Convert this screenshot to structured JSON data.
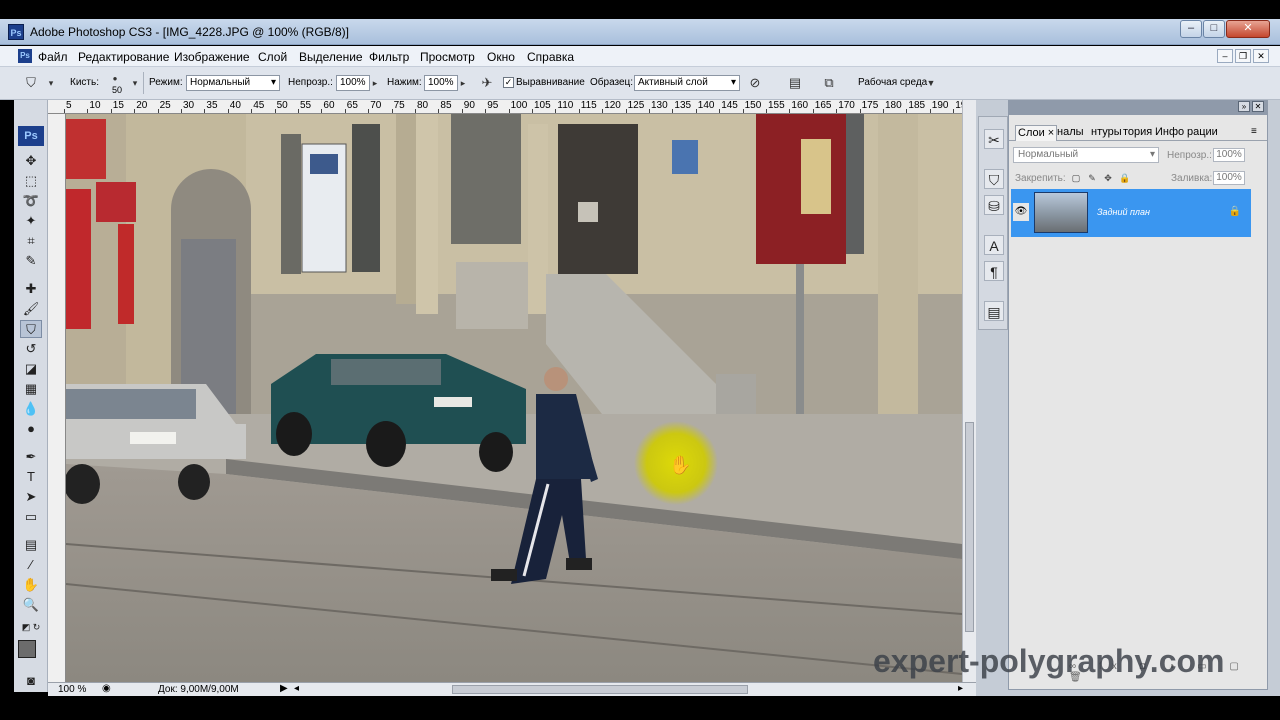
{
  "window": {
    "title": "Adobe Photoshop CS3 - [IMG_4228.JPG @ 100% (RGB/8)]",
    "app_icon": "Ps"
  },
  "menu": {
    "items": [
      "Файл",
      "Редактирование",
      "Изображение",
      "Слой",
      "Выделение",
      "Фильтр",
      "Просмотр",
      "Окно",
      "Справка"
    ]
  },
  "options": {
    "brush_label": "Кисть:",
    "brush_size": "50",
    "mode_label": "Режим:",
    "mode_value": "Нормальный",
    "opacity_label": "Непрозр.:",
    "opacity_value": "100%",
    "flow_label": "Нажим:",
    "flow_value": "100%",
    "aligned_label": "Выравнивание",
    "aligned_checked": true,
    "sample_label": "Образец:",
    "sample_value": "Активный слой",
    "workspace_label": "Рабочая среда"
  },
  "ruler": {
    "top_labels": [
      "5",
      "10",
      "15",
      "20",
      "25",
      "30",
      "35",
      "40",
      "45",
      "50",
      "55",
      "60",
      "65",
      "70",
      "75",
      "80",
      "85",
      "90",
      "95",
      "100",
      "105",
      "110",
      "115",
      "120",
      "125",
      "130",
      "135",
      "140",
      "145",
      "150",
      "155",
      "160",
      "165",
      "170",
      "175",
      "180",
      "185",
      "190",
      "195"
    ]
  },
  "status": {
    "zoom": "100 %",
    "doc_size": "Док: 9,00M/9,00M"
  },
  "layers_panel": {
    "tabs": [
      "Слои",
      "налы",
      "нтуры",
      "тория",
      "Инфо",
      "рации"
    ],
    "blend_mode": "Нормальный",
    "opacity_label": "Непрозр.:",
    "opacity_value": "100%",
    "lock_label": "Закрепить:",
    "fill_label": "Заливка:",
    "fill_value": "100%",
    "layer_name": "Задний план"
  },
  "watermark": "expert-polygraphy.com",
  "colors": {
    "title_bar": "#b9cce4",
    "selected_layer": "#3a96f0",
    "cursor_highlight": "#d6d400"
  }
}
